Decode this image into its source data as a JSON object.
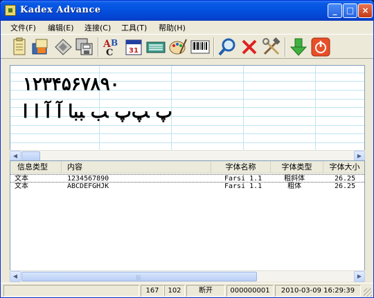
{
  "window": {
    "title": "Kadex Advance"
  },
  "title_buttons": {
    "minimize": "_",
    "maximize": "□",
    "close": "×"
  },
  "menu": [
    "文件(F)",
    "编辑(E)",
    "连接(C)",
    "工具(T)",
    "帮助(H)"
  ],
  "toolbar": [
    "new-icon",
    "open-icon",
    "save-icon",
    "save-as-icon",
    "spell-check-icon",
    "calendar-icon",
    "keyboard-icon",
    "paint-icon",
    "barcode-icon",
    "search-icon",
    "delete-icon",
    "tools-icon",
    "download-icon",
    "power-icon"
  ],
  "preview": {
    "line1": "۱۲۳۴۵۶۷۸۹۰",
    "line2": "ﭖ ﭗﭖ ﺐ ﺒﺒﺎ آ آ ا ا"
  },
  "list": {
    "columns": [
      "信息类型",
      "内容",
      "字体名称",
      "字体类型",
      "字体大小"
    ],
    "rows": [
      {
        "type": "文本",
        "content": "1234567890",
        "font": "Farsi 1.1",
        "style": "粗斜体",
        "size": "26.25"
      },
      {
        "type": "文本",
        "content": "ABCDEFGHJK",
        "font": "Farsi 1.1",
        "style": "粗体",
        "size": "26.25"
      }
    ]
  },
  "status": {
    "x": "167",
    "y": "102",
    "connection": "断开",
    "code": "000000001",
    "datetime": "2010-03-09 16:29:39"
  }
}
